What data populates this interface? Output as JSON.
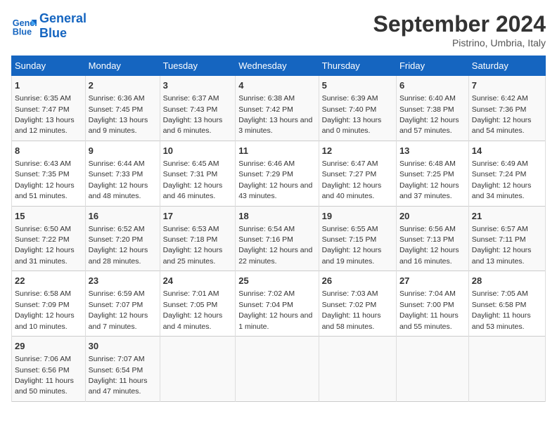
{
  "header": {
    "logo_line1": "General",
    "logo_line2": "Blue",
    "month_title": "September 2024",
    "location": "Pistrino, Umbria, Italy"
  },
  "days_of_week": [
    "Sunday",
    "Monday",
    "Tuesday",
    "Wednesday",
    "Thursday",
    "Friday",
    "Saturday"
  ],
  "weeks": [
    [
      {
        "day": "1",
        "sunrise": "6:35 AM",
        "sunset": "7:47 PM",
        "daylight": "13 hours and 12 minutes."
      },
      {
        "day": "2",
        "sunrise": "6:36 AM",
        "sunset": "7:45 PM",
        "daylight": "13 hours and 9 minutes."
      },
      {
        "day": "3",
        "sunrise": "6:37 AM",
        "sunset": "7:43 PM",
        "daylight": "13 hours and 6 minutes."
      },
      {
        "day": "4",
        "sunrise": "6:38 AM",
        "sunset": "7:42 PM",
        "daylight": "13 hours and 3 minutes."
      },
      {
        "day": "5",
        "sunrise": "6:39 AM",
        "sunset": "7:40 PM",
        "daylight": "13 hours and 0 minutes."
      },
      {
        "day": "6",
        "sunrise": "6:40 AM",
        "sunset": "7:38 PM",
        "daylight": "12 hours and 57 minutes."
      },
      {
        "day": "7",
        "sunrise": "6:42 AM",
        "sunset": "7:36 PM",
        "daylight": "12 hours and 54 minutes."
      }
    ],
    [
      {
        "day": "8",
        "sunrise": "6:43 AM",
        "sunset": "7:35 PM",
        "daylight": "12 hours and 51 minutes."
      },
      {
        "day": "9",
        "sunrise": "6:44 AM",
        "sunset": "7:33 PM",
        "daylight": "12 hours and 48 minutes."
      },
      {
        "day": "10",
        "sunrise": "6:45 AM",
        "sunset": "7:31 PM",
        "daylight": "12 hours and 46 minutes."
      },
      {
        "day": "11",
        "sunrise": "6:46 AM",
        "sunset": "7:29 PM",
        "daylight": "12 hours and 43 minutes."
      },
      {
        "day": "12",
        "sunrise": "6:47 AM",
        "sunset": "7:27 PM",
        "daylight": "12 hours and 40 minutes."
      },
      {
        "day": "13",
        "sunrise": "6:48 AM",
        "sunset": "7:25 PM",
        "daylight": "12 hours and 37 minutes."
      },
      {
        "day": "14",
        "sunrise": "6:49 AM",
        "sunset": "7:24 PM",
        "daylight": "12 hours and 34 minutes."
      }
    ],
    [
      {
        "day": "15",
        "sunrise": "6:50 AM",
        "sunset": "7:22 PM",
        "daylight": "12 hours and 31 minutes."
      },
      {
        "day": "16",
        "sunrise": "6:52 AM",
        "sunset": "7:20 PM",
        "daylight": "12 hours and 28 minutes."
      },
      {
        "day": "17",
        "sunrise": "6:53 AM",
        "sunset": "7:18 PM",
        "daylight": "12 hours and 25 minutes."
      },
      {
        "day": "18",
        "sunrise": "6:54 AM",
        "sunset": "7:16 PM",
        "daylight": "12 hours and 22 minutes."
      },
      {
        "day": "19",
        "sunrise": "6:55 AM",
        "sunset": "7:15 PM",
        "daylight": "12 hours and 19 minutes."
      },
      {
        "day": "20",
        "sunrise": "6:56 AM",
        "sunset": "7:13 PM",
        "daylight": "12 hours and 16 minutes."
      },
      {
        "day": "21",
        "sunrise": "6:57 AM",
        "sunset": "7:11 PM",
        "daylight": "12 hours and 13 minutes."
      }
    ],
    [
      {
        "day": "22",
        "sunrise": "6:58 AM",
        "sunset": "7:09 PM",
        "daylight": "12 hours and 10 minutes."
      },
      {
        "day": "23",
        "sunrise": "6:59 AM",
        "sunset": "7:07 PM",
        "daylight": "12 hours and 7 minutes."
      },
      {
        "day": "24",
        "sunrise": "7:01 AM",
        "sunset": "7:05 PM",
        "daylight": "12 hours and 4 minutes."
      },
      {
        "day": "25",
        "sunrise": "7:02 AM",
        "sunset": "7:04 PM",
        "daylight": "12 hours and 1 minute."
      },
      {
        "day": "26",
        "sunrise": "7:03 AM",
        "sunset": "7:02 PM",
        "daylight": "11 hours and 58 minutes."
      },
      {
        "day": "27",
        "sunrise": "7:04 AM",
        "sunset": "7:00 PM",
        "daylight": "11 hours and 55 minutes."
      },
      {
        "day": "28",
        "sunrise": "7:05 AM",
        "sunset": "6:58 PM",
        "daylight": "11 hours and 53 minutes."
      }
    ],
    [
      {
        "day": "29",
        "sunrise": "7:06 AM",
        "sunset": "6:56 PM",
        "daylight": "11 hours and 50 minutes."
      },
      {
        "day": "30",
        "sunrise": "7:07 AM",
        "sunset": "6:54 PM",
        "daylight": "11 hours and 47 minutes."
      },
      null,
      null,
      null,
      null,
      null
    ]
  ]
}
